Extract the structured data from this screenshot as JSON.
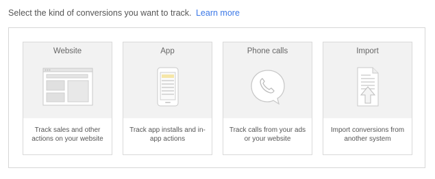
{
  "intro": {
    "text": "Select the kind of conversions you want to track.",
    "link": "Learn more"
  },
  "cards": [
    {
      "title": "Website",
      "description": "Track sales and other actions on your website",
      "icon": "website-icon"
    },
    {
      "title": "App",
      "description": "Track app installs and in-app actions",
      "icon": "phone-app-icon"
    },
    {
      "title": "Phone calls",
      "description": "Track calls from your ads or your website",
      "icon": "phone-call-icon"
    },
    {
      "title": "Import",
      "description": "Import conversions from another system",
      "icon": "import-document-icon"
    }
  ],
  "colors": {
    "link": "#3b78e7",
    "card_top": "#f2f2f2",
    "border": "#d9d9d9",
    "app_highlight": "#f5e6a8"
  }
}
